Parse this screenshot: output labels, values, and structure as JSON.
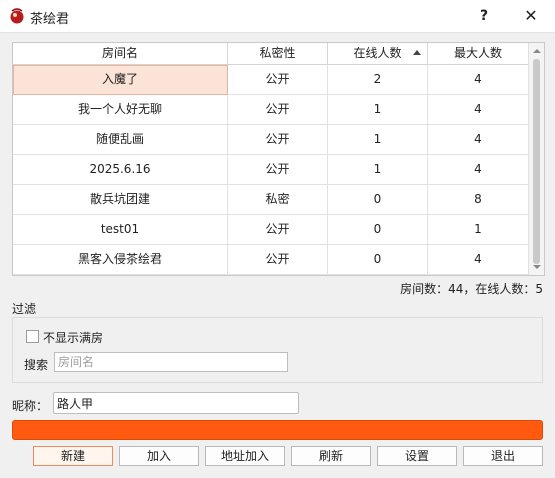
{
  "window": {
    "title": "茶绘君",
    "help_label": "?",
    "close_label": "✕"
  },
  "table": {
    "headers": [
      "房间名",
      "私密性",
      "在线人数",
      "最大人数"
    ],
    "sort_column": 2,
    "rows": [
      [
        "入魔了",
        "公开",
        "2",
        "4"
      ],
      [
        "我一个人好无聊",
        "公开",
        "1",
        "4"
      ],
      [
        "随便乱画",
        "公开",
        "1",
        "4"
      ],
      [
        "2025.6.16",
        "公开",
        "1",
        "4"
      ],
      [
        "散兵坑团建",
        "私密",
        "0",
        "8"
      ],
      [
        "test01",
        "公开",
        "0",
        "1"
      ],
      [
        "黑客入侵茶绘君",
        "公开",
        "0",
        "4"
      ]
    ]
  },
  "stats": "房间数：44，在线人数：5",
  "filter": {
    "label": "过滤",
    "hide_full_label": "不显示满房",
    "search_label": "搜索",
    "search_placeholder": "房间名",
    "search_value": ""
  },
  "nickname": {
    "label": "昵称：",
    "value": "路人甲"
  },
  "color_bar": "#ff5a0f",
  "buttons": [
    "新建",
    "加入",
    "地址加入",
    "刷新",
    "设置",
    "退出"
  ]
}
